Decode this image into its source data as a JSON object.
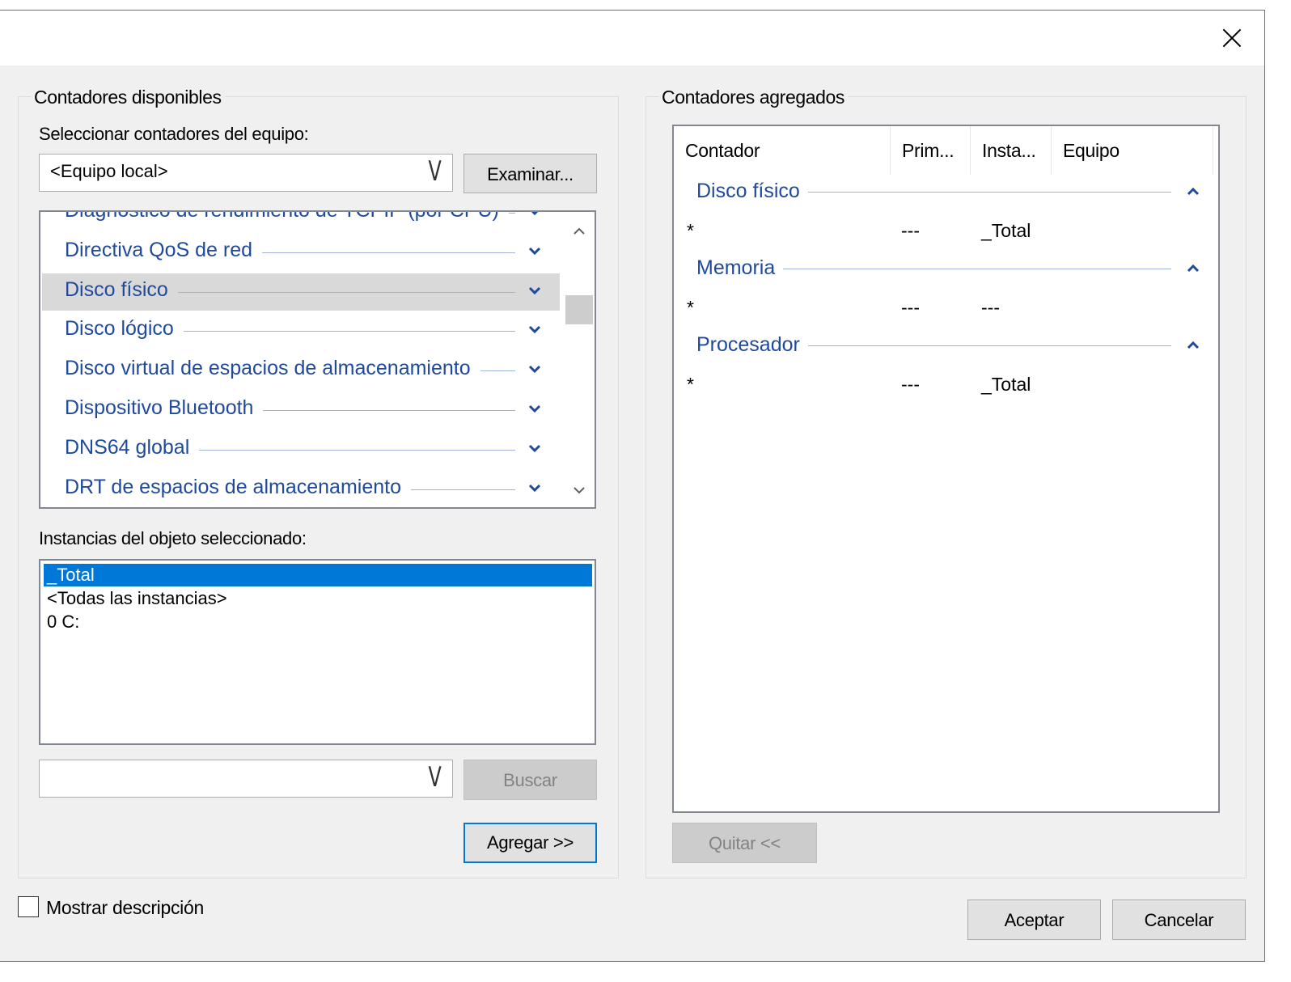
{
  "available": {
    "legend": "Contadores disponibles",
    "computer_label": "Seleccionar contadores del equipo:",
    "computer_value": "<Equipo local>",
    "browse_button": "Examinar...",
    "objects": [
      {
        "label": "Diagnóstico de rendimiento de TCPIP (por CPU)"
      },
      {
        "label": "Directiva QoS de red"
      },
      {
        "label": "Disco físico"
      },
      {
        "label": "Disco lógico"
      },
      {
        "label": "Disco virtual de espacios de almacenamiento"
      },
      {
        "label": "Dispositivo Bluetooth"
      },
      {
        "label": "DNS64 global"
      },
      {
        "label": "DRT de espacios de almacenamiento"
      }
    ],
    "selected_object": "Disco físico",
    "instances_label": "Instancias del objeto seleccionado:",
    "instances": [
      "_Total",
      "<Todas las instancias>",
      "0 C:"
    ],
    "selected_instance": "_Total",
    "search_value": "",
    "search_button": "Buscar",
    "add_button": "Agregar >>"
  },
  "added": {
    "legend": "Contadores agregados",
    "columns": [
      "Contador",
      "Prim...",
      "Insta...",
      "Equipo"
    ],
    "groups": [
      {
        "name": "Disco físico",
        "rows": [
          {
            "counter": "*",
            "parent": "---",
            "instance": "_Total",
            "computer": ""
          }
        ]
      },
      {
        "name": "Memoria",
        "rows": [
          {
            "counter": "*",
            "parent": "---",
            "instance": "---",
            "computer": ""
          }
        ]
      },
      {
        "name": "Procesador",
        "rows": [
          {
            "counter": "*",
            "parent": "---",
            "instance": "_Total",
            "computer": ""
          }
        ]
      }
    ],
    "remove_button": "Quitar <<"
  },
  "footer": {
    "show_description_label": "Mostrar descripción",
    "show_description_checked": false,
    "ok_button": "Aceptar",
    "cancel_button": "Cancelar"
  },
  "colors": {
    "accent": "#0078d7",
    "link_blue": "#1f4a9c",
    "dialog_bg": "#f0f0f0"
  }
}
